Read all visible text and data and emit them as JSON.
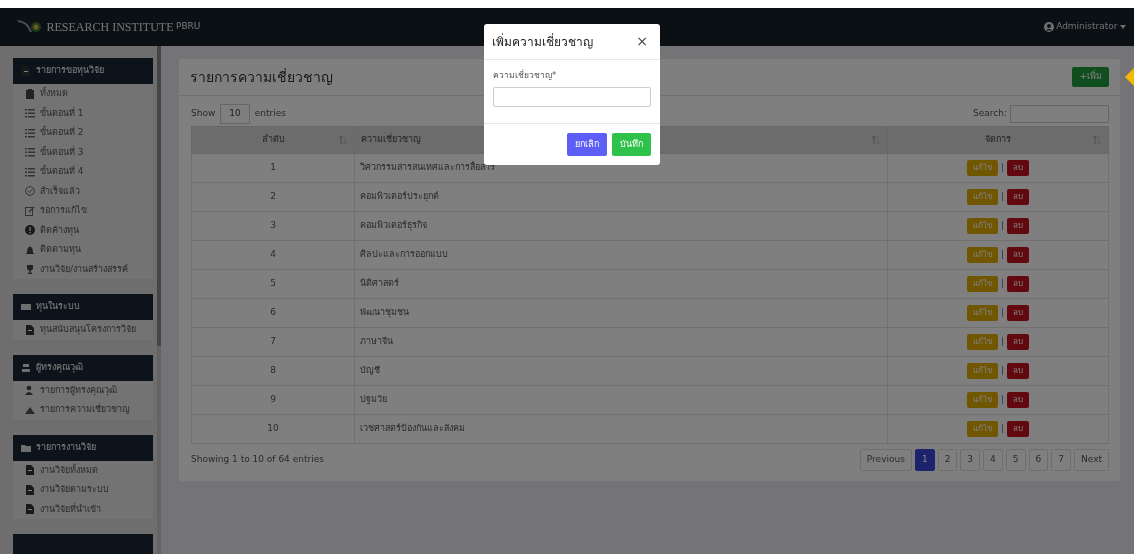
{
  "navbar": {
    "brand": "RESEARCH INSTITUTE",
    "brand_suffix": "PBRU",
    "user": "Administrator"
  },
  "sidebar": {
    "sections": [
      {
        "title": "รายการขอทุนวิจัย",
        "items": [
          "ทั้งหมด",
          "ขั้นตอนที่ 1",
          "ขั้นตอนที่ 2",
          "ขั้นตอนที่ 3",
          "ขั้นตอนที่ 4",
          "สำเร็จแล้ว",
          "รอการแก้ไข",
          "ติดค้างทุน",
          "ติดตามทุน",
          "งานวิจัย/งานสร้างสรรค์"
        ]
      },
      {
        "title": "ทุนในระบบ",
        "items": [
          "ทุนสนับสนุนโครงการวิจัย"
        ]
      },
      {
        "title": "ผู้ทรงคุณวุฒิ",
        "items": [
          "รายการผู้ทรงคุณวุฒิ",
          "รายการความเชี่ยวชาญ"
        ]
      },
      {
        "title": "รายการงานวิจัย",
        "items": [
          "งานวิจัยทั้งหมด",
          "งานวิจัยตามระบบ",
          "งานวิจัยที่นำเข้า"
        ]
      },
      {
        "kind": "cut"
      }
    ]
  },
  "main": {
    "title": "รายการความเชี่ยวชาญ",
    "add_button": "+เพิ่ม",
    "show": "Show",
    "length": "10",
    "entries": "entries",
    "search_label": "Search:",
    "table": {
      "columns": [
        "ลำดับ",
        "ความเชี่ยวชาญ",
        "จัดการ"
      ],
      "rows": [
        {
          "no": "1",
          "name": "วิศวกรรมสารสนเทศและการสื่อสาร",
          "edit": "แก้ไข",
          "separator": "|",
          "delete": "ลบ"
        },
        {
          "no": "2",
          "name": "คอมพิวเตอร์ประยุกต์",
          "edit": "แก้ไข",
          "separator": "|",
          "delete": "ลบ"
        },
        {
          "no": "3",
          "name": "คอมพิวเตอร์ธุรกิจ",
          "edit": "แก้ไข",
          "separator": "|",
          "delete": "ลบ"
        },
        {
          "no": "4",
          "name": "ศิลปะและการออกแบบ",
          "edit": "แก้ไข",
          "separator": "|",
          "delete": "ลบ"
        },
        {
          "no": "5",
          "name": "นิติศาสตร์",
          "edit": "แก้ไข",
          "separator": "|",
          "delete": "ลบ"
        },
        {
          "no": "6",
          "name": "พัฒนาชุมชน",
          "edit": "แก้ไข",
          "separator": "|",
          "delete": "ลบ"
        },
        {
          "no": "7",
          "name": "ภาษาจีน",
          "edit": "แก้ไข",
          "separator": "|",
          "delete": "ลบ"
        },
        {
          "no": "8",
          "name": "บัญชี",
          "edit": "แก้ไข",
          "separator": "|",
          "delete": "ลบ"
        },
        {
          "no": "9",
          "name": "ปฐมวัย",
          "edit": "แก้ไข",
          "separator": "|",
          "delete": "ลบ"
        },
        {
          "no": "10",
          "name": "เวชศาสตร์ป้องกันและสังคม",
          "edit": "แก้ไข",
          "separator": "|",
          "delete": "ลบ"
        }
      ]
    },
    "info": "Showing 1 to 10 of 64 entries",
    "pagination": [
      {
        "label": "Previous",
        "selected": false
      },
      {
        "label": "1",
        "selected": true
      },
      {
        "label": "2",
        "selected": false
      },
      {
        "label": "3",
        "selected": false
      },
      {
        "label": "4",
        "selected": false
      },
      {
        "label": "5",
        "selected": false
      },
      {
        "label": "6",
        "selected": false
      },
      {
        "label": "7",
        "selected": false
      },
      {
        "label": "Next",
        "selected": false
      }
    ]
  },
  "modal": {
    "title": "เพิ่มความเชี่ยวชาญ",
    "close": "×",
    "field_label": "ความเชี่ยวชาญ*",
    "cancel": "ยกเลิก",
    "save": "บันทึก"
  }
}
